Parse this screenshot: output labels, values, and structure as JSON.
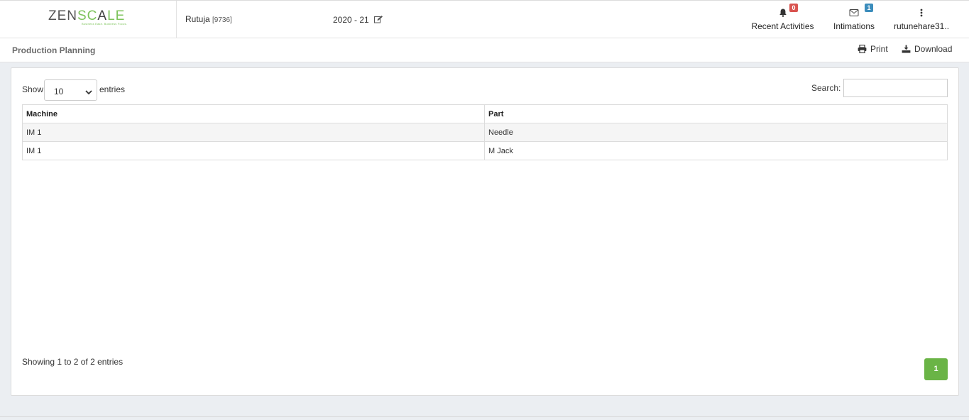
{
  "brand": {
    "logo_left": "ZEN",
    "logo_right": "SC",
    "logo_a": "A",
    "logo_end": "LE",
    "tagline": "Business Ease. Business Focus.",
    "accent_color": "#7cc35a"
  },
  "header": {
    "user_name": "Rutuja",
    "user_id": "[9736]",
    "financial_year": "2020 - 21",
    "nav": {
      "activities": {
        "label": "Recent Activities",
        "badge": "0",
        "icon": "bell-icon"
      },
      "intimations": {
        "label": "Intimations",
        "badge": "1",
        "icon": "envelope-icon"
      },
      "user": {
        "label": "rutunehare31..",
        "icon": "vertical-dots-icon"
      }
    }
  },
  "subheader": {
    "title": "Production Planning",
    "print_label": "Print",
    "download_label": "Download"
  },
  "table_controls": {
    "show_label": "Show",
    "entries_label": "entries",
    "page_length": "10",
    "search_label": "Search:",
    "search_value": ""
  },
  "table": {
    "columns": [
      "Machine",
      "Part"
    ],
    "rows": [
      [
        "IM 1",
        "Needle"
      ],
      [
        "IM 1",
        "M Jack"
      ]
    ]
  },
  "footer": {
    "info": "Showing 1 to 2 of 2 entries",
    "current_page": "1",
    "pager_color": "#6ab446"
  }
}
